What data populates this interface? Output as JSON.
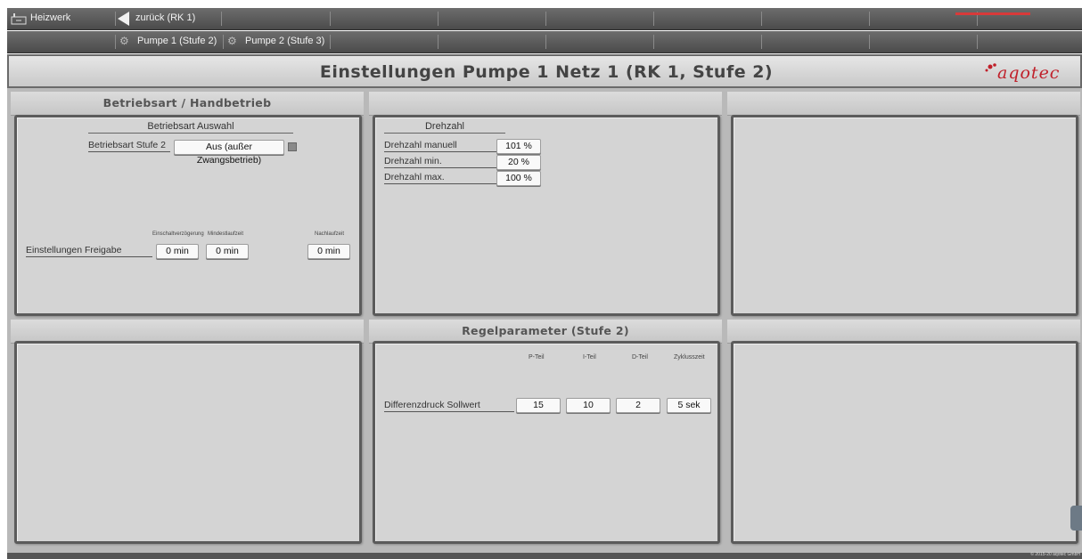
{
  "nav": {
    "home_label": "Heizwerk",
    "back_label": "zurück  (RK 1)",
    "sub_tabs": [
      {
        "label": "Pumpe 1 (Stufe 2)"
      },
      {
        "label": "Pumpe 2 (Stufe 3)"
      }
    ]
  },
  "title": "Einstellungen Pumpe 1 Netz 1  (RK 1, Stufe 2)",
  "logo_text": "aqotec",
  "sections": {
    "betriebsart_title": "Betriebsart / Handbetrieb",
    "regelparameter_title": "Regelparameter  (Stufe 2)"
  },
  "betriebsart": {
    "subtitle": "Betriebsart Auswahl",
    "row_label": "Betriebsart Stufe 2",
    "value": "Aus (außer Zwangsbetrieb)",
    "freigabe_label": "Einstellungen Freigabe",
    "headers": {
      "einschalt": "Einschaltverzögerung",
      "mindest": "Mindestlaufzeit",
      "nachlauf": "Nachlaufzeit"
    },
    "values": {
      "einschalt": "0 min",
      "mindest": "0 min",
      "nachlauf": "0 min"
    }
  },
  "drehzahl": {
    "subtitle": "Drehzahl",
    "rows": [
      {
        "label": "Drehzahl manuell",
        "value": "101 %"
      },
      {
        "label": "Drehzahl min.",
        "value": "20 %"
      },
      {
        "label": "Drehzahl max.",
        "value": "100 %"
      }
    ]
  },
  "regel": {
    "headers": [
      "P-Teil",
      "I-Teil",
      "D-Teil",
      "Zyklusszeit"
    ],
    "row_label": "Differenzdruck Sollwert",
    "values": [
      "15",
      "10",
      "2",
      "5 sek"
    ]
  },
  "footer": {
    "copyright": "© 2015-20 aqotec GmbH"
  },
  "colors": {
    "nav_bg": "#5a5a5a",
    "panel_bg": "#d4d4d4",
    "accent_red": "#d83a3a"
  }
}
